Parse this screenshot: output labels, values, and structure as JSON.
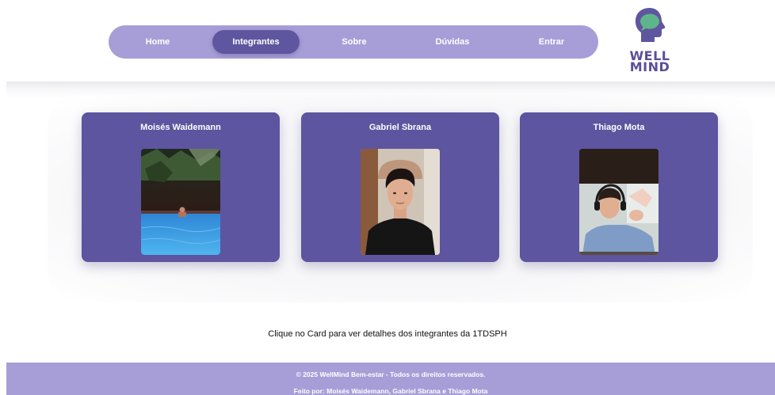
{
  "nav": {
    "items": [
      {
        "label": "Home",
        "active": false
      },
      {
        "label": "Integrantes",
        "active": true
      },
      {
        "label": "Sobre",
        "active": false
      },
      {
        "label": "Dúvidas",
        "active": false
      },
      {
        "label": "Entrar",
        "active": false
      }
    ]
  },
  "logo": {
    "line1": "WELL",
    "line2": "MIND",
    "icon": "head-with-speech-bubble-icon",
    "colors": {
      "head": "#5f56a0",
      "bubble": "#5fb58a"
    }
  },
  "cards": [
    {
      "name": "Moisés Waidemann",
      "photo": "photo-pool-night"
    },
    {
      "name": "Gabriel Sbrana",
      "photo": "photo-portrait-black-shirt"
    },
    {
      "name": "Thiago Mota",
      "photo": "photo-headphones-webcam"
    }
  ],
  "caption": "Clique no Card para ver detalhes dos integrantes da 1TDSPH",
  "footer": {
    "copyright": "© 2025 WellMind Bem-estar - Todos os direitos reservados.",
    "credits": "Feito por: Moisés Waidemann, Gabriel Sbrana e Thiago Mota"
  },
  "colors": {
    "nav_bg": "#a79ed8",
    "nav_active": "#5f56a0",
    "card_bg": "#5d55a0",
    "footer_bg": "#a79ed8"
  }
}
